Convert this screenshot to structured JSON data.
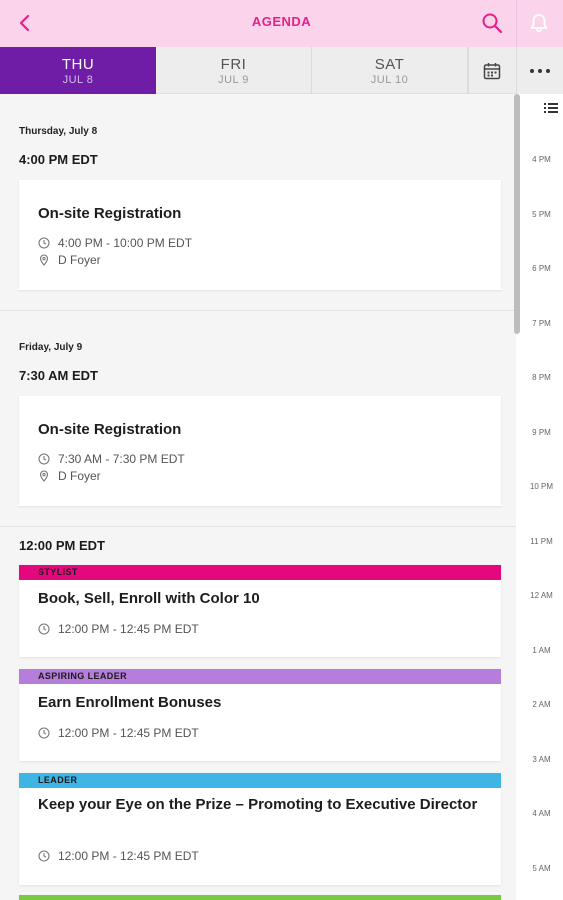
{
  "header": {
    "title": "AGENDA"
  },
  "day_tabs": [
    {
      "day": "THU",
      "date": "JUL 8"
    },
    {
      "day": "FRI",
      "date": "JUL 9"
    },
    {
      "day": "SAT",
      "date": "JUL 10"
    }
  ],
  "sections": [
    {
      "date": "Thursday, July 8",
      "time": "4:00 PM EDT",
      "session": {
        "title": "On-site Registration",
        "time": "4:00 PM - 10:00 PM EDT",
        "location": "D Foyer"
      }
    },
    {
      "date": "Friday, July 9",
      "time": "7:30 AM EDT",
      "session": {
        "title": "On-site Registration",
        "time": "7:30 AM - 7:30 PM EDT",
        "location": "D Foyer"
      }
    },
    {
      "time": "12:00 PM EDT",
      "sessions": [
        {
          "tag": "STYLIST",
          "tag_color": "#e4087f",
          "title": "Book, Sell, Enroll with Color 10",
          "time": "12:00 PM - 12:45 PM EDT"
        },
        {
          "tag": "ASPIRING LEADER",
          "tag_color": "#b67ddb",
          "title": "Earn Enrollment Bonuses",
          "time": "12:00 PM - 12:45 PM EDT"
        },
        {
          "tag": "LEADER",
          "tag_color": "#3fb5e6",
          "title": "Keep your Eye on the Prize – Promoting to Executive Director",
          "time": "12:00 PM - 12:45 PM EDT"
        },
        {
          "tag": "",
          "tag_color": "#7ac943"
        }
      ]
    }
  ],
  "timeline_hours": [
    "4 PM",
    "5 PM",
    "6 PM",
    "7 PM",
    "8 PM",
    "9 PM",
    "10 PM",
    "11 PM",
    "12 AM",
    "1 AM",
    "2 AM",
    "3 AM",
    "4 AM",
    "5 AM"
  ],
  "colors": {
    "header_bg": "#fbd3ea",
    "accent_pink": "#e2228a",
    "active_tab": "#6f1ca6"
  }
}
